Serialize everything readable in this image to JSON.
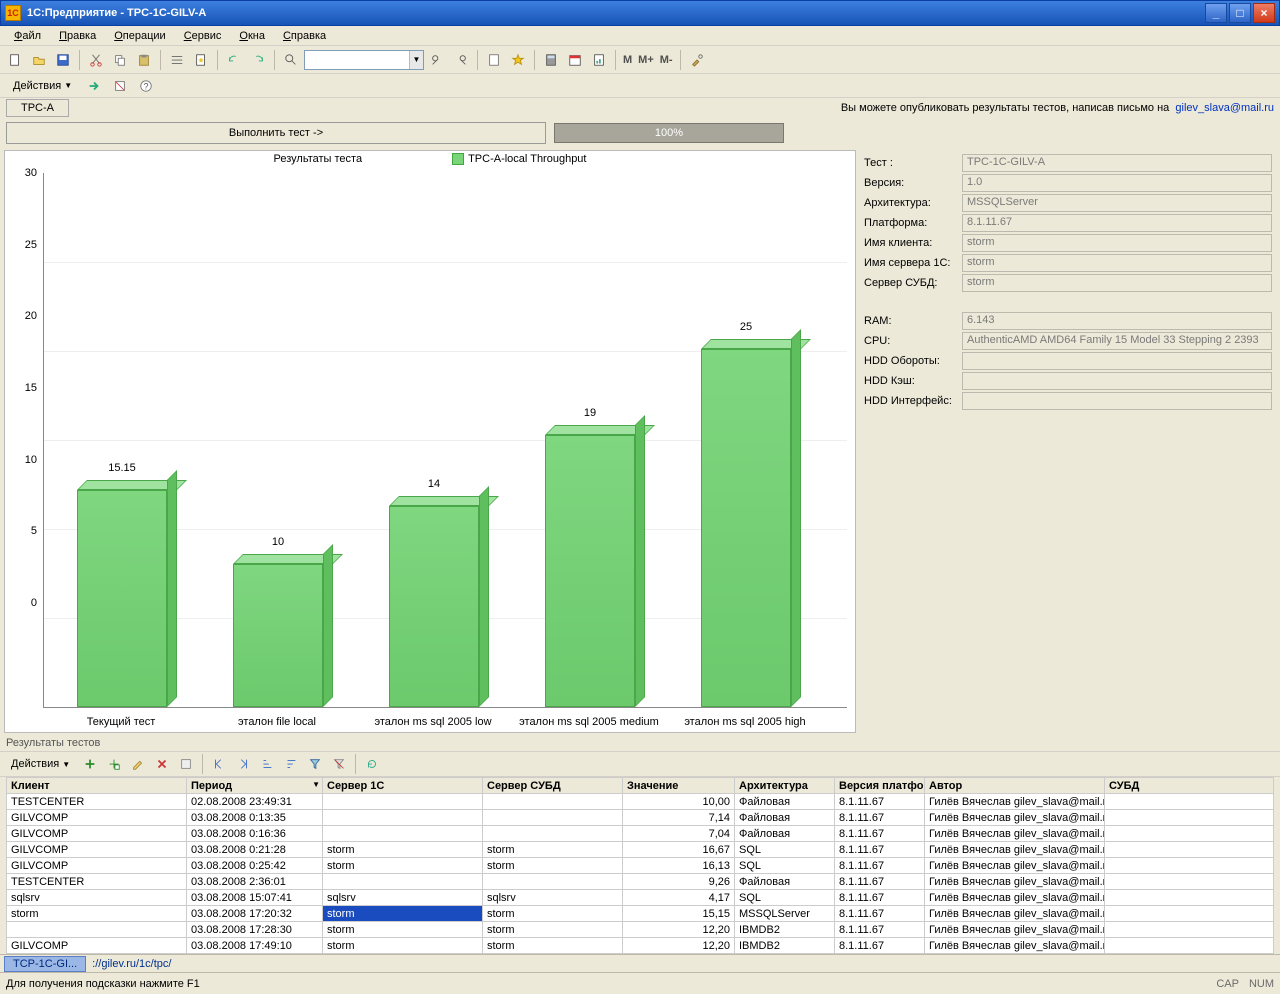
{
  "window": {
    "title": "1С:Предприятие - TPC-1C-GILV-A"
  },
  "menu": [
    "Файл",
    "Правка",
    "Операции",
    "Сервис",
    "Окна",
    "Справка"
  ],
  "actions_label": "Действия",
  "tab_label": "TPC-A",
  "publish_text": "Вы можете опубликовать результаты тестов, написав письмо на",
  "publish_email": "gilev_slava@mail.ru",
  "run_button": "Выполнить тест ->",
  "progress": "100%",
  "chart_title_left": "Результаты теста",
  "chart_legend": "TPC-A-local Throughput",
  "chart_data": {
    "type": "bar",
    "title": "Результаты теста",
    "series_name": "TPC-A-local Throughput",
    "categories": [
      "Текущий тест",
      "эталон file local",
      "эталон ms sql 2005 low",
      "эталон ms sql 2005 medium",
      "эталон ms sql 2005 high"
    ],
    "values": [
      15.15,
      10,
      14,
      19,
      25
    ],
    "ylim": [
      0,
      30
    ],
    "yticks": [
      0,
      5,
      10,
      15,
      20,
      25,
      30
    ],
    "xlabel": "",
    "ylabel": ""
  },
  "info": {
    "rows": [
      {
        "label": "Тест :",
        "value": "TPC-1C-GILV-A"
      },
      {
        "label": "Версия:",
        "value": "1.0"
      },
      {
        "label": "Архитектура:",
        "value": "MSSQLServer"
      },
      {
        "label": "Платформа:",
        "value": "8.1.11.67"
      },
      {
        "label": "Имя клиента:",
        "value": "storm"
      },
      {
        "label": "Имя сервера 1С:",
        "value": "storm"
      },
      {
        "label": "Сервер СУБД:",
        "value": "storm"
      }
    ],
    "rows2": [
      {
        "label": "RAM:",
        "value": "6.143"
      },
      {
        "label": "CPU:",
        "value": "AuthenticAMD AMD64 Family 15 Model 33 Stepping 2 2393"
      },
      {
        "label": "HDD Обороты:",
        "value": ""
      },
      {
        "label": "HDD Кэш:",
        "value": ""
      },
      {
        "label": "HDD Интерфейс:",
        "value": ""
      }
    ]
  },
  "results_title": "Результаты тестов",
  "results_actions": "Действия",
  "table": {
    "columns": [
      "Клиент",
      "Период",
      "Сервер 1С",
      "Сервер СУБД",
      "Значение",
      "Архитектура",
      "Версия платфо...",
      "Автор",
      "СУБД"
    ],
    "rows": [
      {
        "client": "TESTCENTER",
        "period": "02.08.2008 23:49:31",
        "srv1c": "",
        "srvdb": "",
        "val": "10,00",
        "arch": "Файловая",
        "ver": "8.1.11.67",
        "author": "Гилёв Вячеслав gilev_slava@mail.ru",
        "subd": ""
      },
      {
        "client": "GILVCOMP",
        "period": "03.08.2008 0:13:35",
        "srv1c": "",
        "srvdb": "",
        "val": "7,14",
        "arch": "Файловая",
        "ver": "8.1.11.67",
        "author": "Гилёв Вячеслав gilev_slava@mail.ru",
        "subd": ""
      },
      {
        "client": "GILVCOMP",
        "period": "03.08.2008 0:16:36",
        "srv1c": "",
        "srvdb": "",
        "val": "7,04",
        "arch": "Файловая",
        "ver": "8.1.11.67",
        "author": "Гилёв Вячеслав gilev_slava@mail.ru",
        "subd": ""
      },
      {
        "client": "GILVCOMP",
        "period": "03.08.2008 0:21:28",
        "srv1c": "storm",
        "srvdb": "storm",
        "val": "16,67",
        "arch": "SQL",
        "ver": "8.1.11.67",
        "author": "Гилёв Вячеслав gilev_slava@mail.ru",
        "subd": ""
      },
      {
        "client": "GILVCOMP",
        "period": "03.08.2008 0:25:42",
        "srv1c": "storm",
        "srvdb": "storm",
        "val": "16,13",
        "arch": "SQL",
        "ver": "8.1.11.67",
        "author": "Гилёв Вячеслав gilev_slava@mail.ru",
        "subd": ""
      },
      {
        "client": "TESTCENTER",
        "period": "03.08.2008 2:36:01",
        "srv1c": "",
        "srvdb": "",
        "val": "9,26",
        "arch": "Файловая",
        "ver": "8.1.11.67",
        "author": "Гилёв Вячеслав gilev_slava@mail.ru",
        "subd": ""
      },
      {
        "client": "sqlsrv",
        "period": "03.08.2008 15:07:41",
        "srv1c": "sqlsrv",
        "srvdb": "sqlsrv",
        "val": "4,17",
        "arch": "SQL",
        "ver": "8.1.11.67",
        "author": "Гилёв Вячеслав gilev_slava@mail.ru",
        "subd": ""
      },
      {
        "client": "storm",
        "period": "03.08.2008 17:20:32",
        "srv1c": "storm",
        "srvdb": "storm",
        "val": "15,15",
        "arch": "MSSQLServer",
        "ver": "8.1.11.67",
        "author": "Гилёв Вячеслав gilev_slava@mail.ru",
        "subd": "",
        "selected": true
      },
      {
        "client": "",
        "period": "03.08.2008 17:28:30",
        "srv1c": "storm",
        "srvdb": "storm",
        "val": "12,20",
        "arch": "IBMDB2",
        "ver": "8.1.11.67",
        "author": "Гилёв Вячеслав gilev_slava@mail.ru",
        "subd": ""
      },
      {
        "client": "GILVCOMP",
        "period": "03.08.2008 17:49:10",
        "srv1c": "storm",
        "srvdb": "storm",
        "val": "12,20",
        "arch": "IBMDB2",
        "ver": "8.1.11.67",
        "author": "Гилёв Вячеслав gilev_slava@mail.ru",
        "subd": ""
      }
    ]
  },
  "task_chip": "TCP-1C-GI...",
  "task_path": "://gilev.ru/1c/tpc/",
  "status_hint": "Для получения подсказки нажмите F1",
  "status_cap": "CAP",
  "status_num": "NUM"
}
